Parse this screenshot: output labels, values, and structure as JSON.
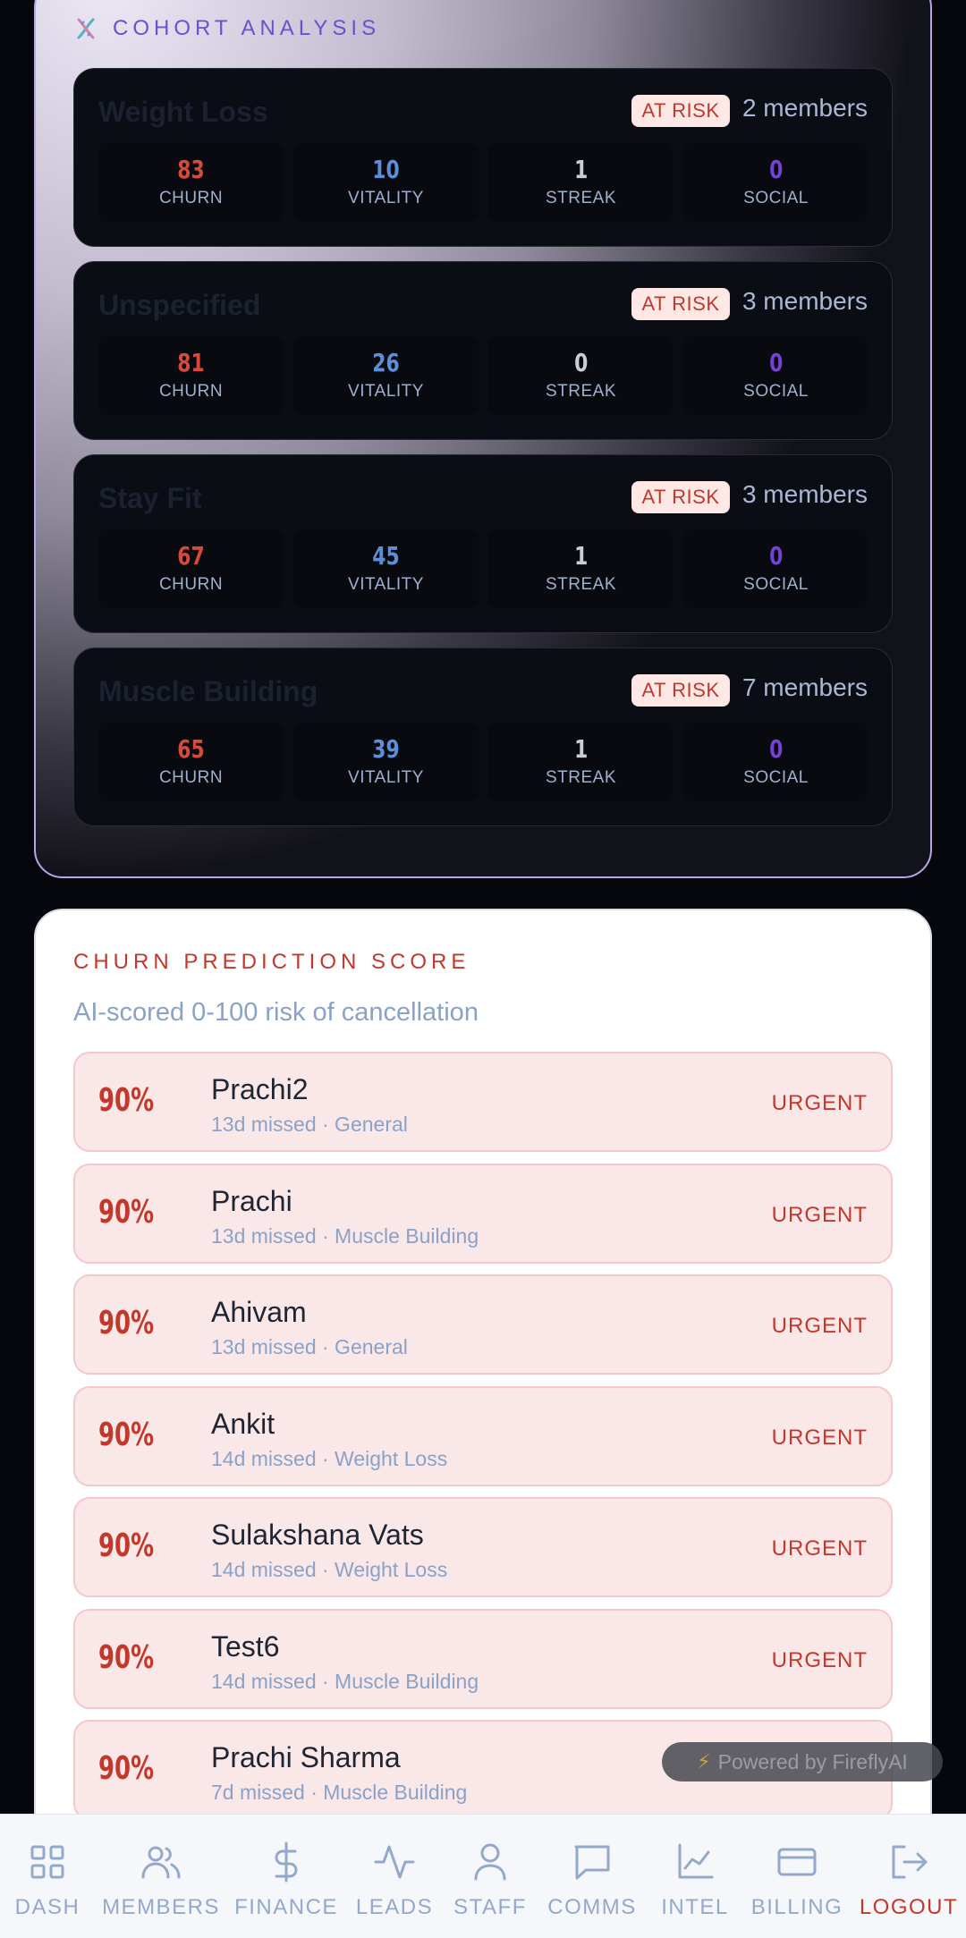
{
  "cohort": {
    "title": "COHORT ANALYSIS",
    "cards": [
      {
        "name": "Weight Loss",
        "badge": "AT RISK",
        "members": "2 members",
        "churn": "83",
        "vitality": "10",
        "streak": "1",
        "social": "0"
      },
      {
        "name": "Unspecified",
        "badge": "AT RISK",
        "members": "3 members",
        "churn": "81",
        "vitality": "26",
        "streak": "0",
        "social": "0"
      },
      {
        "name": "Stay Fit",
        "badge": "AT RISK",
        "members": "3 members",
        "churn": "67",
        "vitality": "45",
        "streak": "1",
        "social": "0"
      },
      {
        "name": "Muscle Building",
        "badge": "AT RISK",
        "members": "7 members",
        "churn": "65",
        "vitality": "39",
        "streak": "1",
        "social": "0"
      }
    ],
    "labels": {
      "churn": "CHURN",
      "vitality": "VITALITY",
      "streak": "STREAK",
      "social": "SOCIAL"
    }
  },
  "churn_prediction": {
    "title": "CHURN PREDICTION SCORE",
    "subtitle": "AI-scored 0-100 risk of cancellation",
    "rows": [
      {
        "score": "90%",
        "name": "Prachi2",
        "meta": "13d missed · General",
        "status": "URGENT"
      },
      {
        "score": "90%",
        "name": "Prachi",
        "meta": "13d missed · Muscle Building",
        "status": "URGENT"
      },
      {
        "score": "90%",
        "name": "Ahivam",
        "meta": "13d missed · General",
        "status": "URGENT"
      },
      {
        "score": "90%",
        "name": "Ankit",
        "meta": "14d missed · Weight Loss",
        "status": "URGENT"
      },
      {
        "score": "90%",
        "name": "Sulakshana Vats",
        "meta": "14d missed · Weight Loss",
        "status": "URGENT"
      },
      {
        "score": "90%",
        "name": "Test6",
        "meta": "14d missed · Muscle Building",
        "status": "URGENT"
      },
      {
        "score": "90%",
        "name": "Prachi Sharma",
        "meta": "7d missed · Muscle Building",
        "status": ""
      }
    ]
  },
  "powered_by": "Powered by FireflyAI",
  "nav": {
    "items": [
      {
        "label": "DASH",
        "icon": "grid-icon"
      },
      {
        "label": "MEMBERS",
        "icon": "users-icon"
      },
      {
        "label": "FINANCE",
        "icon": "dollar-icon"
      },
      {
        "label": "LEADS",
        "icon": "activity-icon"
      },
      {
        "label": "STAFF",
        "icon": "user-icon"
      },
      {
        "label": "COMMS",
        "icon": "message-icon"
      },
      {
        "label": "INTEL",
        "icon": "chart-icon"
      },
      {
        "label": "BILLING",
        "icon": "credit-card-icon"
      },
      {
        "label": "LOGOUT",
        "icon": "logout-icon"
      }
    ]
  },
  "colors": {
    "churn": "#d64a3a",
    "vitality": "#5d8fd8",
    "streak": "#c9ced9",
    "social": "#7443d6",
    "urgent": "#c4372b"
  }
}
